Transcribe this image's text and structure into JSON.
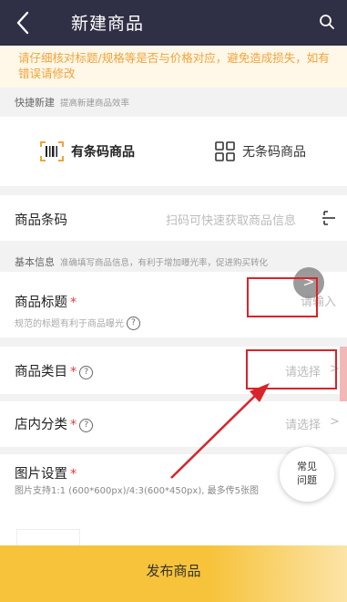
{
  "header": {
    "title": "新建商品"
  },
  "notice": {
    "text": "请仔细核对标题/规格等是否与价格对应，避免造成损失，如有错误请修改"
  },
  "quick": {
    "label": "快捷新建",
    "sub": "提高新建商品效率"
  },
  "types": [
    {
      "label": "有条码商品",
      "icon": "barcode-icon",
      "selected": true
    },
    {
      "label": "无条码商品",
      "icon": "grid-icon",
      "selected": false
    }
  ],
  "barcode": {
    "label": "商品条码",
    "placeholder": "扫码可快速获取商品信息"
  },
  "basic_info": {
    "label": "基本信息",
    "sub": "准确填写商品信息，有利于增加曝光率，促进购买转化"
  },
  "title_field": {
    "label": "商品标题",
    "req": "*",
    "placeholder": "请输入",
    "hint": "规范的标题有利于商品曝光"
  },
  "category": {
    "label": "商品类目",
    "req": "*",
    "placeholder": "请选择"
  },
  "shop_category": {
    "label": "店内分类",
    "req": "*",
    "placeholder": "请选择"
  },
  "image": {
    "label": "图片设置",
    "req": "*",
    "hint": "图片支持1:1 (600*600px)/4:3(600*450px), 最多传5张图"
  },
  "help_glyph": "?",
  "faq": {
    "line1": "常见",
    "line2": "问题"
  },
  "fab_glyph": ">",
  "chevron_glyph": ">",
  "publish": {
    "label": "发布商品"
  },
  "colors": {
    "header": "#2f2f45",
    "notice_text": "#f0a43a",
    "accent": "#f7c33b",
    "required": "#e53b3b",
    "highlight": "#d9232a"
  }
}
